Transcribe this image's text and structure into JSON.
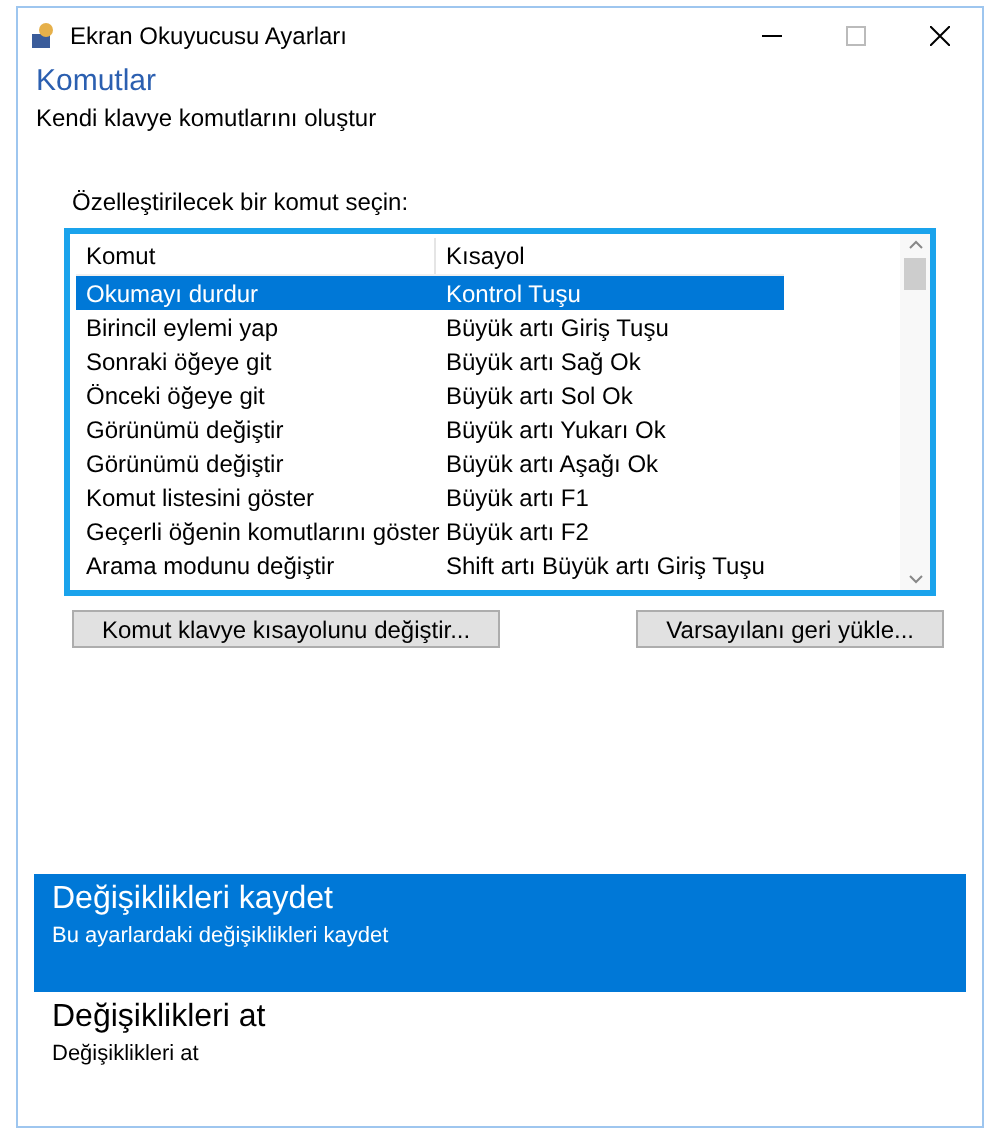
{
  "window": {
    "title": "Ekran Okuyucusu Ayarları"
  },
  "header": {
    "title": "Komutlar",
    "subtitle": "Kendi klavye komutlarını oluştur"
  },
  "list_label": "Özelleştirilecek bir komut seçin:",
  "table": {
    "columns": [
      "Komut",
      "Kısayol"
    ],
    "rows": [
      {
        "command": "Okumayı durdur",
        "shortcut": "Kontrol Tuşu",
        "selected": true
      },
      {
        "command": "Birincil eylemi yap",
        "shortcut": "Büyük artı Giriş Tuşu",
        "selected": false
      },
      {
        "command": "Sonraki öğeye git",
        "shortcut": "Büyük artı Sağ Ok",
        "selected": false
      },
      {
        "command": "Önceki öğeye git",
        "shortcut": "Büyük artı Sol Ok",
        "selected": false
      },
      {
        "command": "Görünümü değiştir",
        "shortcut": "Büyük artı Yukarı Ok",
        "selected": false
      },
      {
        "command": "Görünümü değiştir",
        "shortcut": "Büyük artı Aşağı Ok",
        "selected": false
      },
      {
        "command": "Komut listesini göster",
        "shortcut": "Büyük artı F1",
        "selected": false
      },
      {
        "command": "Geçerli öğenin komutlarını göster",
        "shortcut": "Büyük artı F2",
        "selected": false
      },
      {
        "command": "Arama modunu değiştir",
        "shortcut": "Shift artı Büyük artı Giriş Tuşu",
        "selected": false
      }
    ]
  },
  "buttons": [
    "Komut klavye kısayolunu değiştir...",
    "Varsayılanı geri yükle..."
  ],
  "actions": [
    {
      "title": "Değişiklikleri kaydet",
      "description": "Bu ayarlardaki değişiklikleri kaydet",
      "selected": true
    },
    {
      "title": "Değişiklikleri at",
      "description": "Değişiklikleri at",
      "selected": false
    }
  ]
}
